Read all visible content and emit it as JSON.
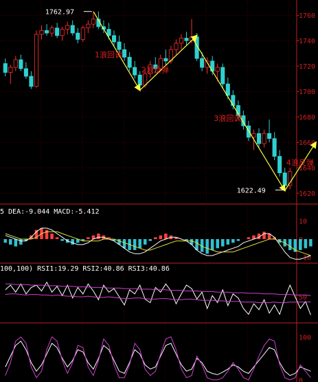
{
  "chart_data": [
    {
      "type": "candlestick",
      "panel": "price",
      "y_ticks": [
        1620,
        1640,
        1660,
        1680,
        1700,
        1720,
        1740,
        1760
      ],
      "ylim": [
        1612,
        1772
      ],
      "colors": {
        "up": "#ff3030",
        "down": "#30d0d0",
        "tick": "#d02020",
        "grid": "#8b0000"
      },
      "candles": [
        {
          "o": 1722,
          "h": 1726,
          "l": 1712,
          "c": 1715
        },
        {
          "o": 1715,
          "h": 1721,
          "l": 1706,
          "c": 1719
        },
        {
          "o": 1719,
          "h": 1728,
          "l": 1716,
          "c": 1725
        },
        {
          "o": 1725,
          "h": 1729,
          "l": 1716,
          "c": 1718
        },
        {
          "o": 1718,
          "h": 1723,
          "l": 1710,
          "c": 1712
        },
        {
          "o": 1712,
          "h": 1716,
          "l": 1702,
          "c": 1704
        },
        {
          "o": 1704,
          "h": 1748,
          "l": 1703,
          "c": 1745
        },
        {
          "o": 1745,
          "h": 1752,
          "l": 1741,
          "c": 1748
        },
        {
          "o": 1748,
          "h": 1753,
          "l": 1744,
          "c": 1746
        },
        {
          "o": 1746,
          "h": 1752,
          "l": 1743,
          "c": 1750
        },
        {
          "o": 1750,
          "h": 1754,
          "l": 1742,
          "c": 1744
        },
        {
          "o": 1744,
          "h": 1751,
          "l": 1740,
          "c": 1749
        },
        {
          "o": 1749,
          "h": 1755,
          "l": 1745,
          "c": 1752
        },
        {
          "o": 1752,
          "h": 1756,
          "l": 1744,
          "c": 1746
        },
        {
          "o": 1746,
          "h": 1750,
          "l": 1738,
          "c": 1741
        },
        {
          "o": 1741,
          "h": 1752,
          "l": 1739,
          "c": 1750
        },
        {
          "o": 1750,
          "h": 1756,
          "l": 1746,
          "c": 1753
        },
        {
          "o": 1753,
          "h": 1762,
          "l": 1750,
          "c": 1757
        },
        {
          "o": 1757,
          "h": 1763,
          "l": 1749,
          "c": 1751
        },
        {
          "o": 1751,
          "h": 1756,
          "l": 1746,
          "c": 1749
        },
        {
          "o": 1749,
          "h": 1754,
          "l": 1741,
          "c": 1744
        },
        {
          "o": 1744,
          "h": 1748,
          "l": 1736,
          "c": 1739
        },
        {
          "o": 1739,
          "h": 1744,
          "l": 1730,
          "c": 1733
        },
        {
          "o": 1733,
          "h": 1738,
          "l": 1724,
          "c": 1727
        },
        {
          "o": 1727,
          "h": 1731,
          "l": 1716,
          "c": 1719
        },
        {
          "o": 1719,
          "h": 1724,
          "l": 1710,
          "c": 1713
        },
        {
          "o": 1713,
          "h": 1716,
          "l": 1702,
          "c": 1705
        },
        {
          "o": 1705,
          "h": 1717,
          "l": 1703,
          "c": 1714
        },
        {
          "o": 1714,
          "h": 1724,
          "l": 1711,
          "c": 1721
        },
        {
          "o": 1721,
          "h": 1727,
          "l": 1715,
          "c": 1718
        },
        {
          "o": 1718,
          "h": 1729,
          "l": 1716,
          "c": 1726
        },
        {
          "o": 1726,
          "h": 1733,
          "l": 1721,
          "c": 1724
        },
        {
          "o": 1724,
          "h": 1736,
          "l": 1722,
          "c": 1733
        },
        {
          "o": 1733,
          "h": 1741,
          "l": 1729,
          "c": 1738
        },
        {
          "o": 1738,
          "h": 1745,
          "l": 1733,
          "c": 1742
        },
        {
          "o": 1742,
          "h": 1747,
          "l": 1736,
          "c": 1740
        },
        {
          "o": 1740,
          "h": 1757,
          "l": 1738,
          "c": 1743
        },
        {
          "o": 1743,
          "h": 1746,
          "l": 1724,
          "c": 1726
        },
        {
          "o": 1726,
          "h": 1731,
          "l": 1716,
          "c": 1719
        },
        {
          "o": 1719,
          "h": 1727,
          "l": 1714,
          "c": 1724
        },
        {
          "o": 1724,
          "h": 1728,
          "l": 1713,
          "c": 1716
        },
        {
          "o": 1716,
          "h": 1722,
          "l": 1708,
          "c": 1719
        },
        {
          "o": 1719,
          "h": 1722,
          "l": 1703,
          "c": 1706
        },
        {
          "o": 1706,
          "h": 1711,
          "l": 1694,
          "c": 1697
        },
        {
          "o": 1697,
          "h": 1701,
          "l": 1686,
          "c": 1689
        },
        {
          "o": 1689,
          "h": 1693,
          "l": 1678,
          "c": 1681
        },
        {
          "o": 1681,
          "h": 1685,
          "l": 1670,
          "c": 1673
        },
        {
          "o": 1673,
          "h": 1677,
          "l": 1661,
          "c": 1664
        },
        {
          "o": 1664,
          "h": 1670,
          "l": 1654,
          "c": 1667
        },
        {
          "o": 1667,
          "h": 1671,
          "l": 1656,
          "c": 1659
        },
        {
          "o": 1659,
          "h": 1670,
          "l": 1656,
          "c": 1667
        },
        {
          "o": 1667,
          "h": 1678,
          "l": 1660,
          "c": 1663
        },
        {
          "o": 1663,
          "h": 1668,
          "l": 1646,
          "c": 1649
        },
        {
          "o": 1649,
          "h": 1654,
          "l": 1633,
          "c": 1636
        },
        {
          "o": 1636,
          "h": 1640,
          "l": 1622,
          "c": 1626
        },
        {
          "o": 1626,
          "h": 1640,
          "l": 1623,
          "c": 1637
        }
      ],
      "price_labels": [
        {
          "text": "1762.97",
          "value": 1762.97,
          "candle": 17,
          "side": "left"
        },
        {
          "text": "1622.49",
          "value": 1622.49,
          "candle": 54,
          "side": "left"
        }
      ],
      "wave_lines": [
        {
          "from": [
            17,
            1763
          ],
          "to": [
            26,
            1701
          ]
        },
        {
          "from": [
            26,
            1701
          ],
          "to": [
            37,
            1744
          ]
        },
        {
          "from": [
            36,
            1743
          ],
          "to": [
            54,
            1622
          ]
        },
        {
          "from": [
            54,
            1622
          ],
          "to": [
            60,
            1660
          ]
        }
      ],
      "annotations": [
        {
          "text": "1浪回调",
          "candle": 21,
          "value": 1727
        },
        {
          "text": "2浪反弹",
          "candle": 30,
          "value": 1715
        },
        {
          "text": "3浪回调",
          "candle": 44,
          "value": 1677
        },
        {
          "text": "4浪反弹",
          "candle": 58,
          "value": 1642
        }
      ]
    },
    {
      "type": "bar+line",
      "panel": "macd",
      "header": "5 DEA:-9.044 MACD:-5.412",
      "y_ticks": [
        10,
        0,
        -10
      ],
      "ylim": [
        -12,
        12
      ],
      "histogram": [
        -2,
        -3,
        -4,
        -3,
        -1,
        2,
        5,
        6,
        5,
        3,
        1,
        -1,
        -2,
        -3,
        -2,
        -1,
        1,
        2,
        3,
        2,
        1,
        -1,
        -3,
        -5,
        -6,
        -6,
        -5,
        -3,
        -1,
        1,
        2,
        3,
        2,
        1,
        0,
        -1,
        -3,
        -6,
        -7,
        -8,
        -6,
        -5,
        -4,
        -3,
        -2,
        -1,
        0,
        1,
        2,
        3,
        4,
        3,
        1,
        -2,
        -4,
        -6,
        -7,
        -6,
        -5,
        -4
      ],
      "dif": [
        2,
        1,
        0,
        -1,
        -1,
        1,
        4,
        6,
        6,
        5,
        3,
        1,
        -1,
        -2,
        -3,
        -3,
        -2,
        0,
        1,
        1,
        0,
        -1,
        -3,
        -5,
        -7,
        -8,
        -8,
        -7,
        -5,
        -3,
        -1,
        0,
        1,
        1,
        0,
        -1,
        -3,
        -6,
        -8,
        -9,
        -9,
        -8,
        -7,
        -6,
        -5,
        -4,
        -2,
        -1,
        0,
        1,
        3,
        3,
        1,
        -3,
        -7,
        -10,
        -11,
        -11,
        -10,
        -9
      ],
      "dea": [
        3,
        2,
        1,
        0,
        0,
        0,
        1,
        3,
        4,
        4,
        4,
        3,
        2,
        1,
        0,
        -1,
        -1,
        -1,
        -1,
        0,
        0,
        0,
        -1,
        -2,
        -3,
        -4,
        -5,
        -6,
        -6,
        -5,
        -4,
        -3,
        -2,
        -1,
        -1,
        -1,
        -1,
        -2,
        -4,
        -5,
        -6,
        -7,
        -7,
        -7,
        -7,
        -6,
        -5,
        -4,
        -3,
        -2,
        -1,
        0,
        0,
        -1,
        -2,
        -4,
        -6,
        -7,
        -8,
        -9
      ],
      "colors": {
        "pos": "#ff4040",
        "neg": "#30c0d0",
        "dif": "#ffffff",
        "dea": "#e0e040"
      }
    },
    {
      "type": "line",
      "panel": "rsi_short",
      "header": "100,100) RSI1:19.29 RSI2:40.86 RSI3:40.86",
      "y_ticks": [
        50
      ],
      "ylim": [
        10,
        90
      ],
      "series": [
        {
          "name": "RSI1",
          "color": "#ffffff",
          "values": [
            62,
            70,
            58,
            72,
            55,
            66,
            70,
            60,
            75,
            58,
            68,
            52,
            70,
            48,
            66,
            55,
            72,
            60,
            45,
            70,
            58,
            64,
            50,
            36,
            62,
            55,
            70,
            46,
            40,
            66,
            58,
            72,
            60,
            38,
            55,
            70,
            64,
            46,
            58,
            30,
            52,
            40,
            62,
            35,
            55,
            48,
            30,
            20,
            38,
            28,
            45,
            22,
            36,
            20,
            48,
            70,
            50,
            30,
            42,
            19
          ]
        },
        {
          "name": "RSI2",
          "color": "#d040d0",
          "values": [
            72,
            72,
            71,
            71,
            71,
            70,
            70,
            70,
            69,
            69,
            69,
            68,
            68,
            68,
            67,
            67,
            67,
            66,
            66,
            66,
            65,
            65,
            65,
            64,
            64,
            64,
            63,
            63,
            63,
            62,
            62,
            62,
            61,
            61,
            61,
            60,
            60,
            60,
            59,
            59,
            59,
            58,
            58,
            58,
            57,
            57,
            57,
            56,
            56,
            56,
            55,
            55,
            55,
            54,
            54,
            54,
            53,
            53,
            53,
            52
          ]
        },
        {
          "name": "RSI3",
          "color": "#d040d0",
          "values": [
            54,
            55,
            55,
            54,
            53,
            54,
            54,
            53,
            53,
            52,
            53,
            52,
            51,
            51,
            50,
            50,
            51,
            50,
            49,
            49,
            50,
            49,
            48,
            47,
            47,
            48,
            48,
            47,
            46,
            46,
            47,
            47,
            46,
            45,
            45,
            46,
            46,
            45,
            44,
            44,
            44,
            43,
            43,
            42,
            42,
            42,
            41,
            41,
            41,
            40,
            40,
            40,
            41,
            40,
            40,
            41,
            41,
            41,
            41,
            41
          ]
        }
      ]
    },
    {
      "type": "line",
      "panel": "rsi_long",
      "y_ticks": [
        100,
        0
      ],
      "ylim": [
        -5,
        110
      ],
      "series": [
        {
          "name": "line1",
          "color": "#ffffff",
          "values": [
            30,
            55,
            80,
            90,
            70,
            40,
            20,
            35,
            60,
            85,
            75,
            50,
            30,
            45,
            70,
            65,
            40,
            25,
            50,
            80,
            70,
            45,
            20,
            15,
            40,
            70,
            60,
            35,
            25,
            30,
            55,
            80,
            85,
            60,
            35,
            20,
            25,
            50,
            40,
            20,
            15,
            12,
            18,
            25,
            35,
            30,
            20,
            15,
            30,
            45,
            60,
            75,
            70,
            40,
            20,
            10,
            15,
            30,
            25,
            20
          ]
        },
        {
          "name": "line2",
          "color": "#d040d0",
          "values": [
            10,
            40,
            90,
            100,
            85,
            30,
            5,
            20,
            70,
            100,
            90,
            45,
            15,
            40,
            80,
            75,
            30,
            10,
            45,
            95,
            80,
            35,
            5,
            5,
            35,
            85,
            70,
            25,
            10,
            20,
            60,
            95,
            100,
            70,
            25,
            5,
            10,
            55,
            35,
            5,
            0,
            0,
            5,
            20,
            40,
            25,
            5,
            0,
            25,
            55,
            80,
            95,
            90,
            35,
            5,
            0,
            5,
            35,
            20,
            5
          ]
        }
      ]
    }
  ]
}
